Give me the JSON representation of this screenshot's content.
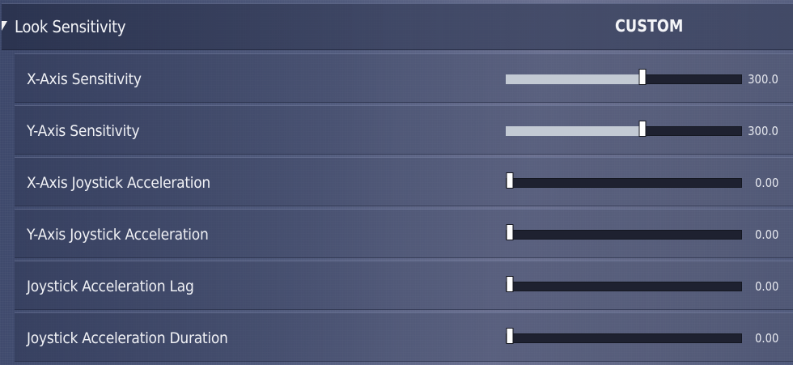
{
  "header": {
    "label": "Look Sensitivity",
    "value": "CUSTOM"
  },
  "settings": [
    {
      "label": "X-Axis Sensitivity",
      "value_text": "300.0",
      "fraction": 0.58
    },
    {
      "label": "Y-Axis Sensitivity",
      "value_text": "300.0",
      "fraction": 0.58
    },
    {
      "label": "X-Axis Joystick Acceleration",
      "value_text": "0.00",
      "fraction": 0.0
    },
    {
      "label": "Y-Axis Joystick Acceleration",
      "value_text": "0.00",
      "fraction": 0.0
    },
    {
      "label": "Joystick Acceleration Lag",
      "value_text": "0.00",
      "fraction": 0.0
    },
    {
      "label": "Joystick Acceleration Duration",
      "value_text": "0.00",
      "fraction": 0.0
    }
  ],
  "colors": {
    "track": "#1e2130",
    "fill": "#c3cad4",
    "thumb": "#ffffff",
    "text": "#f0f1f5"
  }
}
